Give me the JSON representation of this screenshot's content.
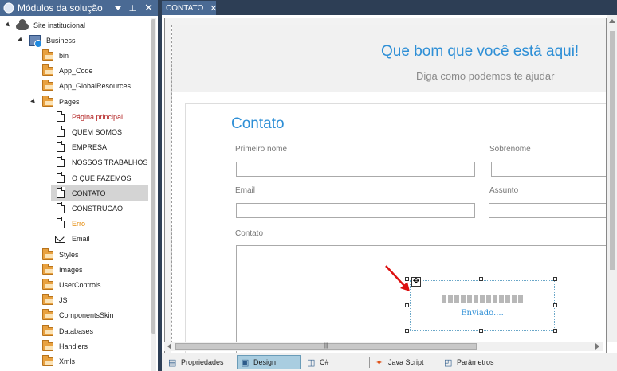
{
  "left_panel": {
    "title": "Módulos da solução",
    "pin_glyph": "⊥",
    "close_glyph": "✕",
    "tree": [
      {
        "label": "Site institucional",
        "icon": "cloud-icon",
        "level": 0,
        "expanded": true
      },
      {
        "label": "Business",
        "icon": "project-icon",
        "level": 1,
        "expanded": true
      },
      {
        "label": "bin",
        "icon": "folder-icon",
        "level": 2
      },
      {
        "label": "App_Code",
        "icon": "folder-icon",
        "level": 2
      },
      {
        "label": "App_GlobalResources",
        "icon": "folder-icon",
        "level": 2
      },
      {
        "label": "Pages",
        "icon": "folder-icon",
        "level": 2,
        "expanded": true
      },
      {
        "label": "Página principal",
        "icon": "page-icon",
        "level": 3,
        "color": "#b21f1f"
      },
      {
        "label": "QUEM SOMOS",
        "icon": "page-icon",
        "level": 3
      },
      {
        "label": "EMPRESA",
        "icon": "page-icon",
        "level": 3
      },
      {
        "label": "NOSSOS TRABALHOS",
        "icon": "page-icon",
        "level": 3
      },
      {
        "label": "O QUE FAZEMOS",
        "icon": "page-icon",
        "level": 3
      },
      {
        "label": "CONTATO",
        "icon": "page-icon",
        "level": 3,
        "selected": true
      },
      {
        "label": "CONSTRUCAO",
        "icon": "page-icon",
        "level": 3
      },
      {
        "label": "Erro",
        "icon": "page-icon",
        "level": 3,
        "color": "#e58b0a"
      },
      {
        "label": "Email",
        "icon": "mail-icon",
        "level": 3
      },
      {
        "label": "Styles",
        "icon": "folder-icon",
        "level": 2
      },
      {
        "label": "Images",
        "icon": "folder-icon",
        "level": 2
      },
      {
        "label": "UserControls",
        "icon": "folder-icon",
        "level": 2
      },
      {
        "label": "JS",
        "icon": "folder-icon",
        "level": 2
      },
      {
        "label": "ComponentsSkin",
        "icon": "folder-icon",
        "level": 2
      },
      {
        "label": "Databases",
        "icon": "folder-icon",
        "level": 2
      },
      {
        "label": "Handlers",
        "icon": "folder-icon",
        "level": 2
      },
      {
        "label": "Xmls",
        "icon": "folder-icon",
        "level": 2
      }
    ]
  },
  "editor": {
    "tab_label": "CONTATO",
    "tab_close": "✕",
    "hero_title": "Que bom que você está aqui!",
    "hero_subtitle": "Diga como podemos te ajudar",
    "form_title": "Contato",
    "labels": {
      "first_name": "Primeiro nome",
      "last_name": "Sobrenome",
      "email": "Email",
      "subject": "Assunto",
      "message": "Contato"
    },
    "control_status": "Enviado....",
    "move_glyph": "✥",
    "hscroll_grip": "|||"
  },
  "bottom_tabs": [
    {
      "label": "Propriedades",
      "icon": "properties-icon"
    },
    {
      "label": "Design",
      "icon": "design-icon",
      "active": true
    },
    {
      "label": "C#",
      "icon": "csharp-icon"
    },
    {
      "label": "Java Script",
      "icon": "javascript-icon"
    },
    {
      "label": "Parâmetros",
      "icon": "parameters-icon"
    }
  ],
  "colors": {
    "accent": "#2e8fd6",
    "panel_header": "#4a6a94",
    "frame": "#2d3e55",
    "selected_row": "#d4d4d4"
  }
}
